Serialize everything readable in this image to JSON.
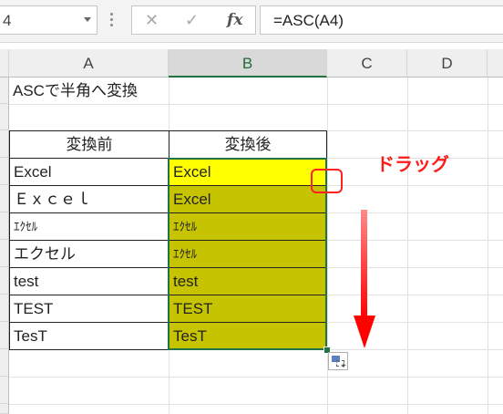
{
  "formula_bar": {
    "name_box": "4",
    "cancel_icon": "✕",
    "enter_icon": "✓",
    "fx_label": "fx",
    "formula": "=ASC(A4)"
  },
  "columns": [
    "A",
    "B",
    "C",
    "D"
  ],
  "cells": {
    "a1": "ASCで半角へ変換",
    "a3": "変換前",
    "b3": "変換後",
    "a4": "Excel",
    "a5": "Ｅｘｃｅｌ",
    "a6": "ｴｸｾﾙ",
    "a7": "エクセル",
    "a8": "test",
    "a9": "TEST",
    "a10": "TesT",
    "b4": "Excel",
    "b5": "Excel",
    "b6": "ｴｸｾﾙ",
    "b7": "ｴｸｾﾙ",
    "b8": "test",
    "b9": "TEST",
    "b10": "TesT"
  },
  "annotation": {
    "drag_label": "ドラッグ",
    "color": "#ff0000"
  },
  "colors": {
    "fill_olive": "#c6c300",
    "fill_yellow": "#ffff00",
    "selection": "#217346"
  }
}
